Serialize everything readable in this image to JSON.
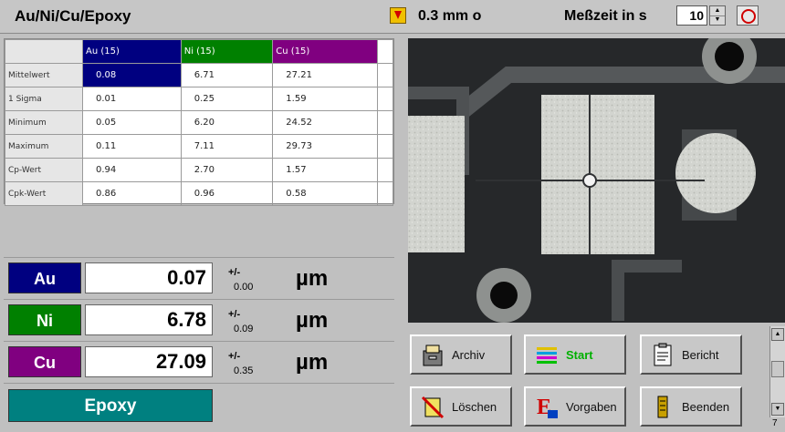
{
  "header": {
    "title": "Au/Ni/Cu/Epoxy",
    "spot_size": "0.3 mm o",
    "measure_time_label": "Meßzeit in s",
    "measure_time_value": "10",
    "spin_up": "▲",
    "spin_down": "▼"
  },
  "stats": {
    "columns": [
      "Au (15)",
      "Ni (15)",
      "Cu (15)"
    ],
    "column_colors": [
      "#000080",
      "#008000",
      "#800080"
    ],
    "rows": [
      {
        "label": "Mittelwert",
        "values": [
          "0.08",
          "6.71",
          "27.21"
        ]
      },
      {
        "label": "1 Sigma",
        "values": [
          "0.01",
          "0.25",
          "1.59"
        ]
      },
      {
        "label": "Minimum",
        "values": [
          "0.05",
          "6.20",
          "24.52"
        ]
      },
      {
        "label": "Maximum",
        "values": [
          "0.11",
          "7.11",
          "29.73"
        ]
      },
      {
        "label": "Cp-Wert",
        "values": [
          "0.94",
          "2.70",
          "1.57"
        ]
      },
      {
        "label": "Cpk-Wert",
        "values": [
          "0.86",
          "0.96",
          "0.58"
        ]
      }
    ]
  },
  "results": [
    {
      "element": "Au",
      "color": "#000080",
      "value": "0.07",
      "pm": "+/-",
      "dev": "0.00",
      "unit": "µm"
    },
    {
      "element": "Ni",
      "color": "#008000",
      "value": "6.78",
      "pm": "+/-",
      "dev": "0.09",
      "unit": "µm"
    },
    {
      "element": "Cu",
      "color": "#800080",
      "value": "27.09",
      "pm": "+/-",
      "dev": "0.35",
      "unit": "µm"
    }
  ],
  "substrate": {
    "label": "Epoxy",
    "color": "#008080"
  },
  "buttons": {
    "archiv": "Archiv",
    "start": "Start",
    "bericht": "Bericht",
    "loeschen": "Löschen",
    "vorgaben": "Vorgaben",
    "beenden": "Beenden"
  },
  "scroll": {
    "up": "▲",
    "down": "▼",
    "corner": "7"
  }
}
